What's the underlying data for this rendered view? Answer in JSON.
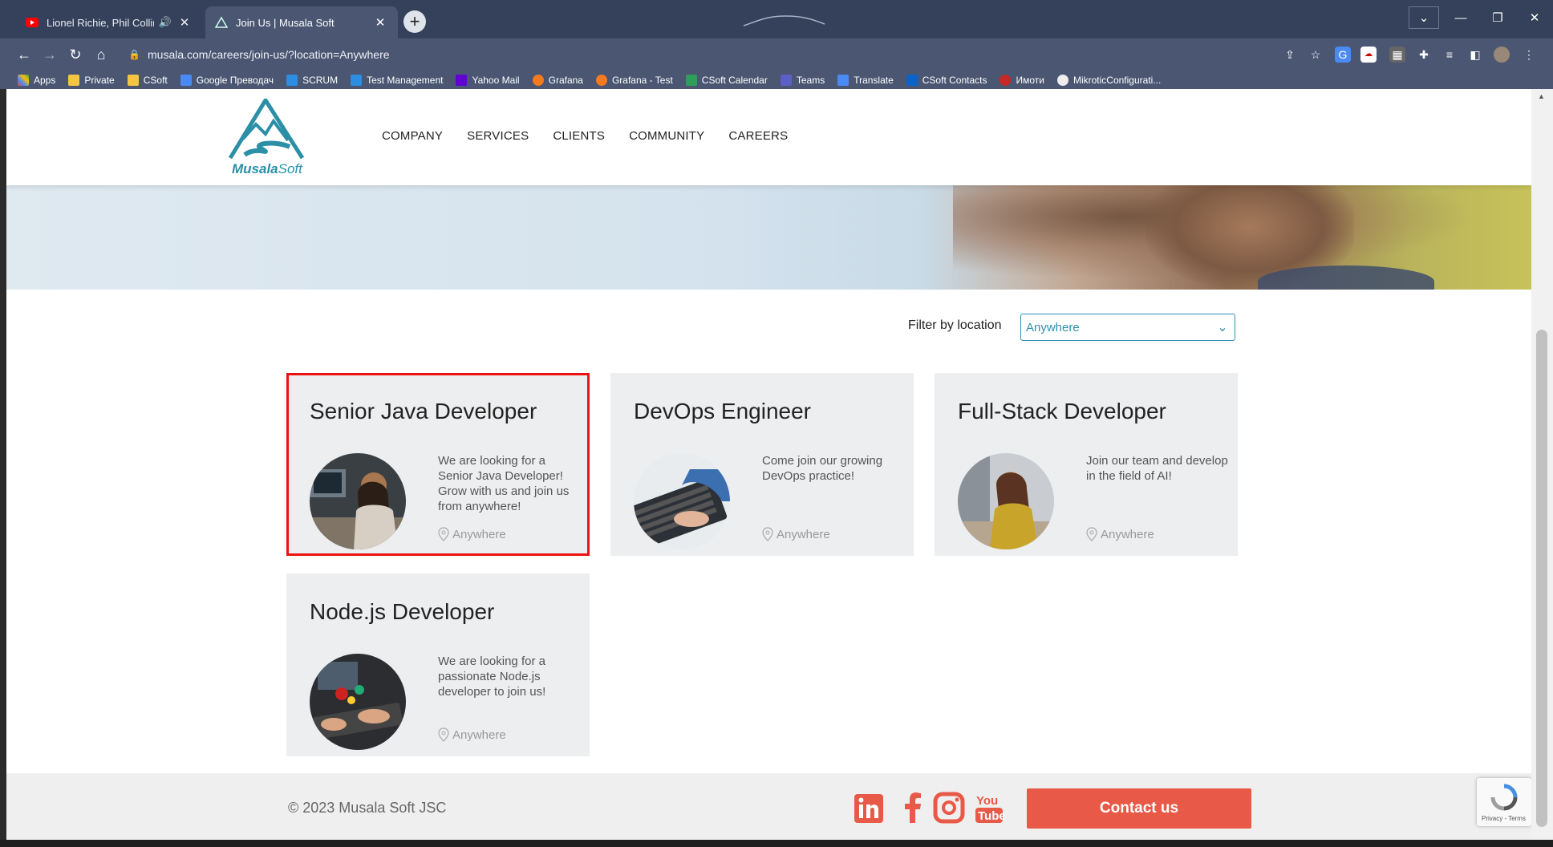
{
  "browser": {
    "tabs": [
      {
        "title": "Lionel Richie, Phil Collins, Ro",
        "favicon": "youtube-icon",
        "audio_icon": "speaker-icon",
        "active": false
      },
      {
        "title": "Join Us | Musala Soft",
        "favicon": "musala-icon",
        "active": true
      }
    ],
    "new_tab_label": "+",
    "url": "musala.com/careers/join-us/?location=Anywhere",
    "bookmarks": [
      {
        "label": "Apps",
        "icon": "apps-grid-icon",
        "color": "#e44"
      },
      {
        "label": "Private",
        "icon": "folder-icon",
        "color": "#f4c542"
      },
      {
        "label": "CSoft",
        "icon": "folder-icon",
        "color": "#f4c542"
      },
      {
        "label": "Google Преводач",
        "icon": "google-translate-icon",
        "color": "#4a8af4"
      },
      {
        "label": "SCRUM",
        "icon": "azure-devops-icon",
        "color": "#2d8de0"
      },
      {
        "label": "Test Management",
        "icon": "azure-devops-icon",
        "color": "#2d8de0"
      },
      {
        "label": "Yahoo Mail",
        "icon": "yahoo-mail-icon",
        "color": "#6001d2"
      },
      {
        "label": "Grafana",
        "icon": "grafana-icon",
        "color": "#f47a20"
      },
      {
        "label": "Grafana - Test",
        "icon": "grafana-icon",
        "color": "#f47a20"
      },
      {
        "label": "CSoft Calendar",
        "icon": "calendar-icon",
        "color": "#2e9e5b"
      },
      {
        "label": "Teams",
        "icon": "teams-icon",
        "color": "#5b5fc7"
      },
      {
        "label": "Translate",
        "icon": "google-translate-icon",
        "color": "#4a8af4"
      },
      {
        "label": "CSoft Contacts",
        "icon": "outlook-icon",
        "color": "#0a64c8"
      },
      {
        "label": "Имоти",
        "icon": "imoti-icon",
        "color": "#c62828"
      },
      {
        "label": "MikroticConfigurati...",
        "icon": "mikrotik-icon",
        "color": "#eeeeee"
      }
    ]
  },
  "site": {
    "logo_text_bold": "Musala",
    "logo_text_light": "Soft",
    "nav": [
      "COMPANY",
      "SERVICES",
      "CLIENTS",
      "COMMUNITY",
      "CAREERS"
    ],
    "filter_label": "Filter by location",
    "filter_value": "Anywhere",
    "jobs": [
      {
        "title": "Senior Java Developer",
        "description": "We are looking for a Senior Java Developer! Grow with us and join us from anywhere!",
        "location": "Anywhere",
        "selected": true
      },
      {
        "title": "DevOps Engineer",
        "description": "Come join our growing DevOps practice!",
        "location": "Anywhere",
        "selected": false
      },
      {
        "title": "Full-Stack Developer",
        "description": "Join our team and develop in the field of AI!",
        "location": "Anywhere",
        "selected": false
      },
      {
        "title": "Node.js Developer",
        "description": "We are looking for a passionate Node.js developer to join us!",
        "location": "Anywhere",
        "selected": false
      }
    ],
    "copyright": "© 2023 Musala Soft JSC",
    "social": [
      "linkedin-icon",
      "facebook-icon",
      "instagram-icon",
      "youtube-icon"
    ],
    "contact_button": "Contact us",
    "recaptcha_text": "Privacy - Terms"
  },
  "colors": {
    "brand": "#2b8fa6",
    "accent": "#e85a47",
    "selection_outline": "#ee1111"
  }
}
